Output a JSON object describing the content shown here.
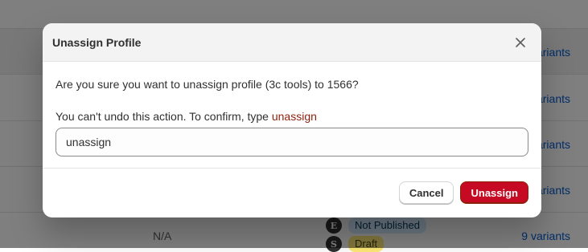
{
  "background": {
    "rows": [
      {
        "link": "variants"
      },
      {
        "link": "variants"
      },
      {
        "link": "variants"
      },
      {
        "link": "variants"
      },
      {
        "na": "N/A",
        "link": "9 variants",
        "statuses": [
          {
            "icon_letter": "E",
            "label": "Not Published"
          },
          {
            "icon_letter": "S",
            "label": "Draft"
          }
        ]
      }
    ]
  },
  "modal": {
    "title": "Unassign Profile",
    "confirm_text": "Are you sure you want to unassign profile (3c tools) to 1566?",
    "instruction_prefix": "You can't undo this action. To confirm, type ",
    "instruction_keyword": "unassign",
    "input_value": "unassign",
    "cancel_label": "Cancel",
    "confirm_label": "Unassign"
  },
  "colors": {
    "danger": "#c70a24",
    "keyword": "#8e1f0b",
    "link": "#005bd3"
  }
}
